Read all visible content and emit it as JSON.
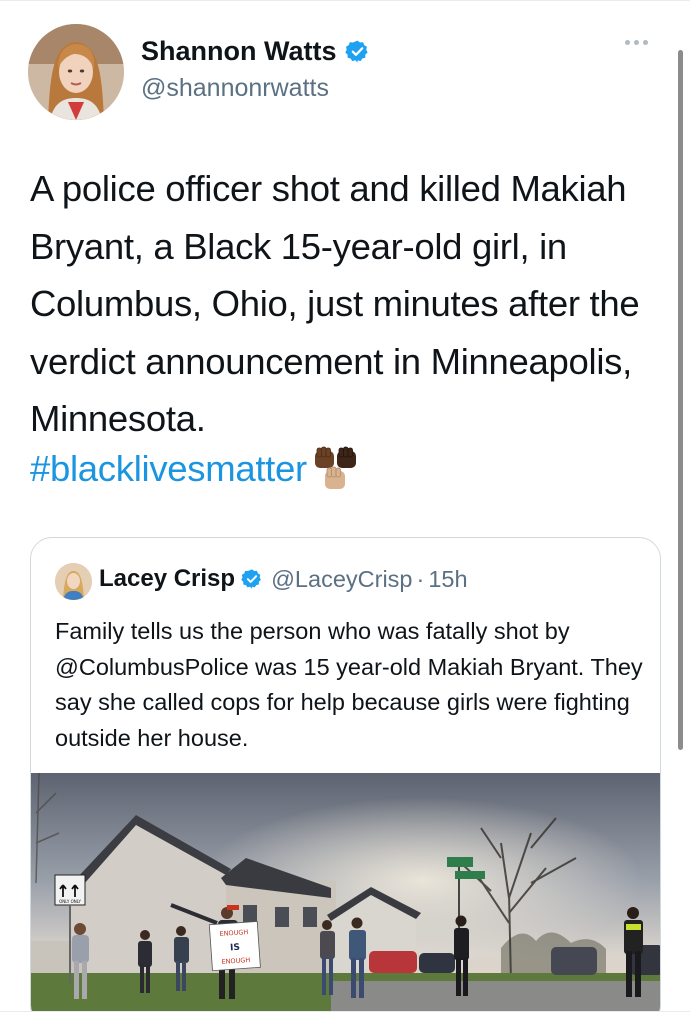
{
  "tweet": {
    "author": {
      "display_name": "Shannon Watts",
      "handle": "@shannonrwatts",
      "verified": true
    },
    "more_icon": "more-horizontal-icon",
    "text": "A police officer shot and killed Makiah Bryant, a Black 15-year-old girl, in Columbus, Ohio, just minutes after the verdict announcement in Minneapolis, Minnesota.",
    "hashtag": "#blacklivesmatter",
    "emoji": "raised-fists-emoji"
  },
  "quoted_tweet": {
    "author": {
      "display_name": "Lacey Crisp",
      "handle": "@LaceyCrisp",
      "verified": true
    },
    "separator": "·",
    "time": "15h",
    "text": "Family tells us the person who was fatally shot by @ColumbusPolice was 15 year-old Makiah Bryant. They say she called cops for help because girls were fighting outside her house.",
    "image": {
      "sign_lines": [
        "ENOUGH",
        "IS",
        "ENOUGH"
      ],
      "street_sign_text": "ONLY ONLY"
    }
  },
  "colors": {
    "link_blue": "#1b95e0",
    "verified_blue": "#1da1f2",
    "secondary_text": "#5b7083",
    "border": "#cfd9de"
  }
}
